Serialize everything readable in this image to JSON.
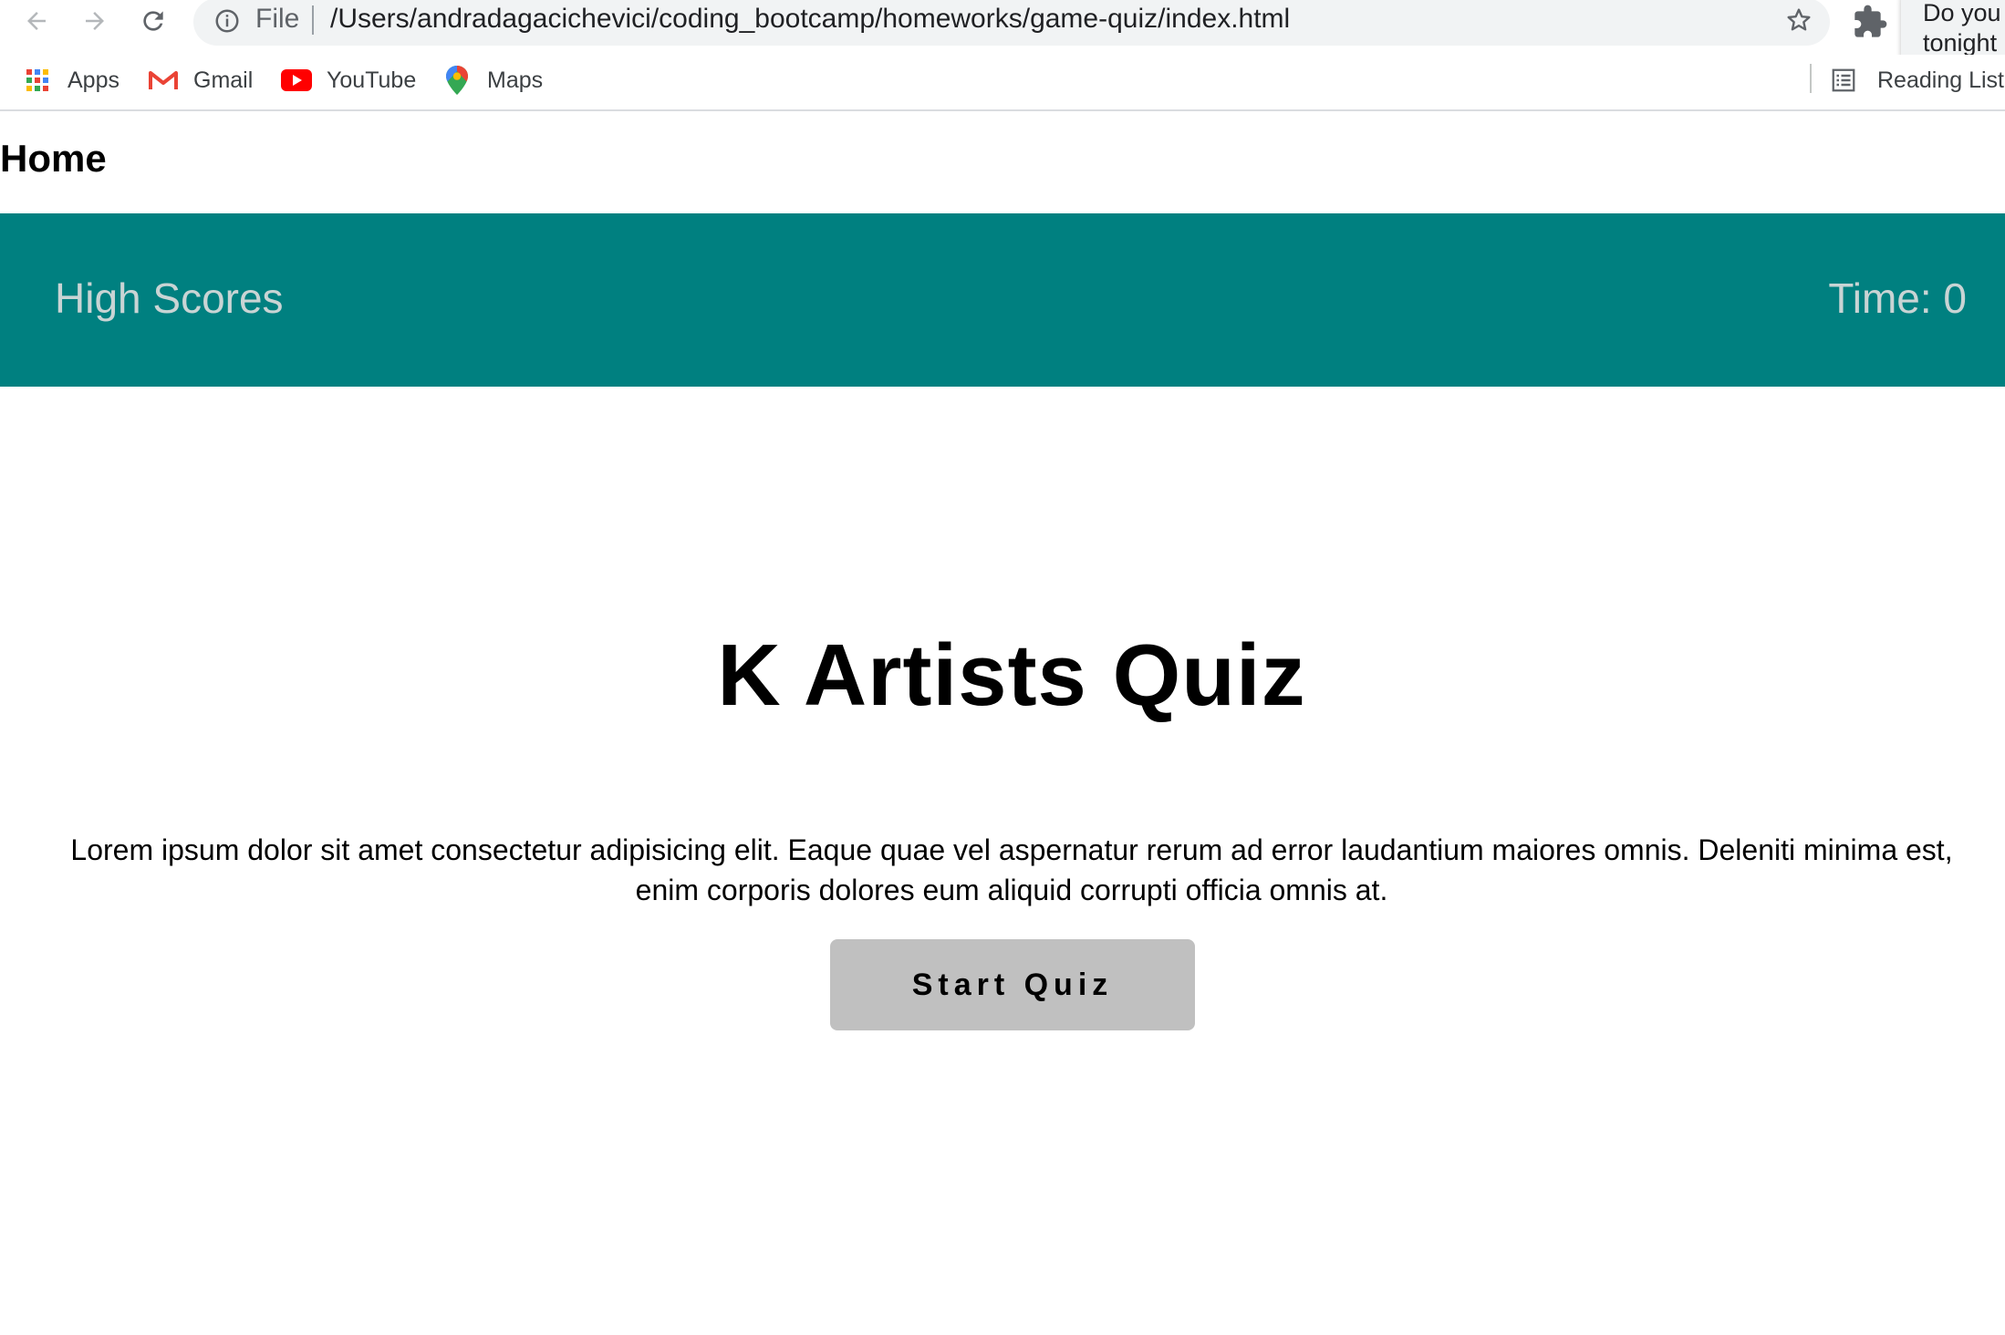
{
  "browser": {
    "address_scheme": "File",
    "url": "/Users/andradagacichevici/coding_bootcamp/homeworks/game-quiz/index.html",
    "popup_text_line1": "Do you",
    "popup_text_line2": "tonight"
  },
  "bookmarks": {
    "items": [
      {
        "label": "Apps",
        "icon": "apps-grid-icon"
      },
      {
        "label": "Gmail",
        "icon": "gmail-icon"
      },
      {
        "label": "YouTube",
        "icon": "youtube-icon"
      },
      {
        "label": "Maps",
        "icon": "maps-icon"
      }
    ],
    "reading_list_label": "Reading List"
  },
  "page": {
    "home_label": "Home",
    "high_scores_label": "High Scores",
    "timer_label": "Time: 0",
    "title": "K Artists Quiz",
    "description": "Lorem ipsum dolor sit amet consectetur adipisicing elit. Eaque quae vel aspernatur rerum ad error laudantium maiores omnis. Deleniti minima est, enim corporis dolores eum aliquid corrupti officia omnis at.",
    "start_button_label": "Start Quiz"
  },
  "colors": {
    "header_bar": "#008080",
    "header_text": "#c9d4d4",
    "button_bg": "#c0c0c0"
  }
}
